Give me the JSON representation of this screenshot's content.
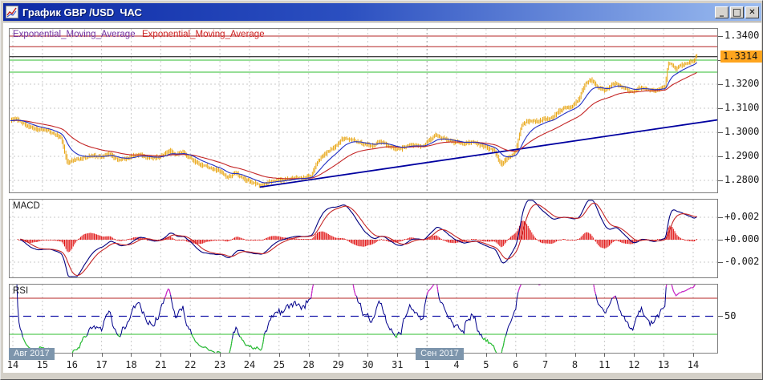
{
  "window": {
    "title": "График GBP /USD  ЧАС",
    "icon": "chart-icon",
    "controls": [
      {
        "name": "minimize",
        "glyph": "_"
      },
      {
        "name": "maximize",
        "glyph": "□"
      },
      {
        "name": "close",
        "glyph": "✕"
      }
    ]
  },
  "legend": {
    "ema_fast_label": "Exponential_Moving_Average",
    "ema_slow_label": "Exponential_Moving_Average"
  },
  "macd_panel": {
    "label": "MACD",
    "axis_labels": [
      "+0.002",
      "+0.000",
      "-0.002"
    ],
    "axis_values": [
      0.002,
      0,
      -0.002
    ]
  },
  "rsi_panel": {
    "label": "RSI",
    "axis_labels": [
      "50"
    ],
    "axis_values": [
      50
    ]
  },
  "price_axis": {
    "tick_labels": [
      "1.3400",
      "1.3300",
      "1.3200",
      "1.3100",
      "1.3000",
      "1.2900",
      "1.2800"
    ],
    "tick_values": [
      1.34,
      1.33,
      1.32,
      1.31,
      1.3,
      1.29,
      1.28
    ],
    "current_price_label": "1.3314",
    "current_price": 1.3314,
    "current_tag_bg": "#FFA51E"
  },
  "time_axis": {
    "day_labels": [
      "14",
      "15",
      "16",
      "17",
      "18",
      "21",
      "22",
      "23",
      "24",
      "25",
      "28",
      "29",
      "30",
      "31",
      "1",
      "4",
      "5",
      "6",
      "7",
      "8",
      "11",
      "12",
      "13",
      "14"
    ],
    "months": [
      {
        "label": "Авг 2017",
        "day_index": 0
      },
      {
        "label": "Сен 2017",
        "day_index": 14
      }
    ]
  },
  "chart_data": {
    "type": "candlestick",
    "symbol": "GBP/USD",
    "timeframe": "1 hour",
    "title": "График GBP /USD ЧАС",
    "y_range": [
      1.277,
      1.342
    ],
    "y_tick_step": 0.01,
    "grid": true,
    "last_price": 1.3314,
    "price_anchors": [
      [
        -0.15,
        1.3048
      ],
      [
        0.1,
        1.3056
      ],
      [
        0.4,
        1.303
      ],
      [
        0.8,
        1.3008
      ],
      [
        1.1,
        1.2998
      ],
      [
        1.45,
        1.2988
      ],
      [
        1.65,
        1.2962
      ],
      [
        1.85,
        1.2864
      ],
      [
        2.05,
        1.2882
      ],
      [
        2.35,
        1.2892
      ],
      [
        2.7,
        1.2896
      ],
      [
        3.0,
        1.2888
      ],
      [
        3.3,
        1.2902
      ],
      [
        3.6,
        1.2878
      ],
      [
        3.9,
        1.2888
      ],
      [
        4.3,
        1.2902
      ],
      [
        4.7,
        1.2892
      ],
      [
        5.0,
        1.2902
      ],
      [
        5.25,
        1.2918
      ],
      [
        5.5,
        1.2902
      ],
      [
        5.75,
        1.2912
      ],
      [
        6.0,
        1.2896
      ],
      [
        6.3,
        1.2868
      ],
      [
        6.65,
        1.285
      ],
      [
        6.95,
        1.2836
      ],
      [
        7.25,
        1.2814
      ],
      [
        7.55,
        1.2826
      ],
      [
        7.85,
        1.2806
      ],
      [
        8.15,
        1.2788
      ],
      [
        8.4,
        1.2776
      ],
      [
        8.7,
        1.279
      ],
      [
        9.1,
        1.2794
      ],
      [
        9.5,
        1.2804
      ],
      [
        9.85,
        1.2814
      ],
      [
        10.1,
        1.2826
      ],
      [
        10.3,
        1.288
      ],
      [
        10.65,
        1.2925
      ],
      [
        10.95,
        1.295
      ],
      [
        11.2,
        1.2978
      ],
      [
        11.5,
        1.2962
      ],
      [
        11.85,
        1.2948
      ],
      [
        12.15,
        1.2942
      ],
      [
        12.45,
        1.2956
      ],
      [
        12.75,
        1.2936
      ],
      [
        13.05,
        1.2928
      ],
      [
        13.45,
        1.2942
      ],
      [
        13.85,
        1.2934
      ],
      [
        14.1,
        1.2965
      ],
      [
        14.3,
        1.2988
      ],
      [
        14.6,
        1.297
      ],
      [
        14.9,
        1.2956
      ],
      [
        15.25,
        1.2952
      ],
      [
        15.55,
        1.2966
      ],
      [
        15.95,
        1.294
      ],
      [
        16.25,
        1.2924
      ],
      [
        16.5,
        1.2866
      ],
      [
        16.75,
        1.2894
      ],
      [
        17.0,
        1.2918
      ],
      [
        17.2,
        1.3032
      ],
      [
        17.55,
        1.3046
      ],
      [
        17.9,
        1.3058
      ],
      [
        18.2,
        1.3066
      ],
      [
        18.5,
        1.3094
      ],
      [
        18.8,
        1.311
      ],
      [
        19.1,
        1.3136
      ],
      [
        19.35,
        1.3206
      ],
      [
        19.55,
        1.3222
      ],
      [
        19.8,
        1.3186
      ],
      [
        20.05,
        1.3182
      ],
      [
        20.35,
        1.3208
      ],
      [
        20.65,
        1.3184
      ],
      [
        20.95,
        1.3166
      ],
      [
        21.25,
        1.3184
      ],
      [
        21.55,
        1.3172
      ],
      [
        21.85,
        1.3178
      ],
      [
        22.05,
        1.3184
      ],
      [
        22.15,
        1.3284
      ],
      [
        22.4,
        1.3262
      ],
      [
        22.65,
        1.3274
      ],
      [
        22.9,
        1.329
      ],
      [
        23.05,
        1.33
      ],
      [
        23.12,
        1.3326
      ],
      [
        23.18,
        1.3314
      ]
    ],
    "hlines": [
      {
        "price": 1.34,
        "color": "#B42424"
      },
      {
        "price": 1.3356,
        "color": "#B42424"
      },
      {
        "price": 1.3314,
        "color": "#000000"
      },
      {
        "price": 1.33,
        "color": "#2EBE2E"
      },
      {
        "price": 1.325,
        "color": "#2EBE2E"
      }
    ],
    "trendline": {
      "from_day": 8.35,
      "from_price": 1.2772,
      "to_day": 23.85,
      "to_price": 1.3052,
      "color": "#0000A0"
    },
    "indicators": {
      "ema_fast_period": 16,
      "ema_slow_period": 48,
      "macd": {
        "fast": 12,
        "slow": 26,
        "signal": 9,
        "grid_values": [
          0.002,
          0,
          -0.002
        ]
      },
      "rsi": {
        "period": 14,
        "overbought": 70,
        "mid": 50,
        "oversold": 30
      }
    },
    "series_colors": {
      "bars": "#E8A512",
      "ema_fast": "#2230C4",
      "ema_slow": "#C42626",
      "macd_line": "#00007F",
      "macd_signal": "#C42626",
      "macd_hist": "#E01010",
      "rsi_line": "#00008B",
      "rsi_overbought": "#D928C9",
      "rsi_oversold": "#2ECC2E",
      "grid": "#C9C9C9",
      "grid_month": "#979797",
      "mid_dashed": "#1A1AAA"
    }
  }
}
